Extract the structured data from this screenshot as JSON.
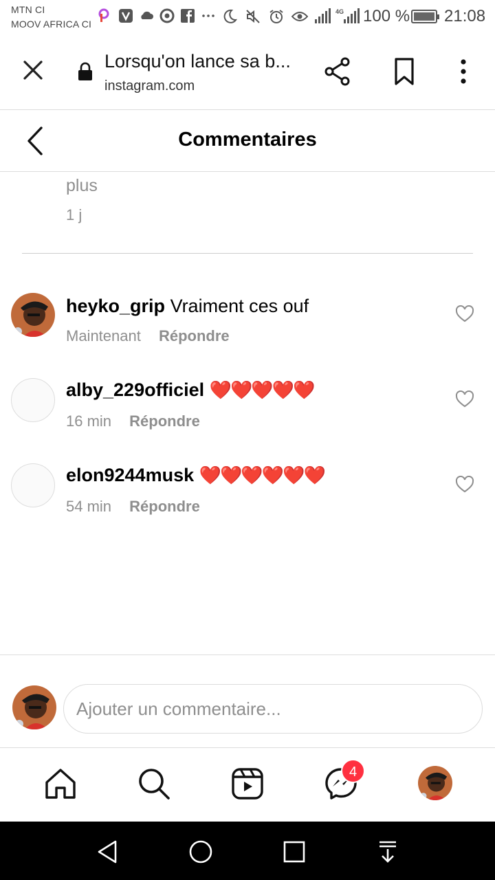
{
  "status_bar": {
    "carrier_1": "MTN CI",
    "carrier_2": "MOOV AFRICA CI",
    "battery_text": "100 %",
    "time": "21:08",
    "network": "4G",
    "battery_level": 100
  },
  "browser": {
    "title": "Lorsqu'on lance sa b...",
    "domain": "instagram.com"
  },
  "header": {
    "title": "Commentaires"
  },
  "previous_comment": {
    "more_text": "plus",
    "time": "1 j"
  },
  "comments": [
    {
      "username": "heyko_grip",
      "text": "Vraiment ces ouf",
      "time": "Maintenant",
      "reply_label": "Répondre"
    },
    {
      "username": "alby_229officiel",
      "text": "❤️❤️❤️❤️❤️",
      "time": "16 min",
      "reply_label": "Répondre"
    },
    {
      "username": "elon9244musk",
      "text": "❤️❤️❤️❤️❤️❤️",
      "time": "54 min",
      "reply_label": "Répondre"
    }
  ],
  "input": {
    "placeholder": "Ajouter un commentaire..."
  },
  "bottom_nav": {
    "messages_badge": "4"
  },
  "colors": {
    "badge": "#ff3040",
    "heart": "#e8242f",
    "secondary_text": "#8e8e8e"
  },
  "icons": {
    "status_notifications": [
      "picsart-icon",
      "vtc-icon",
      "cloud-icon",
      "chrome-icon",
      "facebook-icon",
      "more-icon"
    ],
    "status_system": [
      "moon-icon",
      "mute-icon",
      "alarm-icon",
      "eye-icon"
    ],
    "browser": [
      "close-icon",
      "lock-icon",
      "share-icon",
      "bookmark-icon",
      "more-vertical-icon"
    ],
    "nav": [
      "home-icon",
      "search-icon",
      "reels-icon",
      "messenger-icon",
      "profile-avatar"
    ],
    "android": [
      "back-triangle-icon",
      "home-circle-icon",
      "recents-square-icon",
      "notification-pull-icon"
    ]
  }
}
